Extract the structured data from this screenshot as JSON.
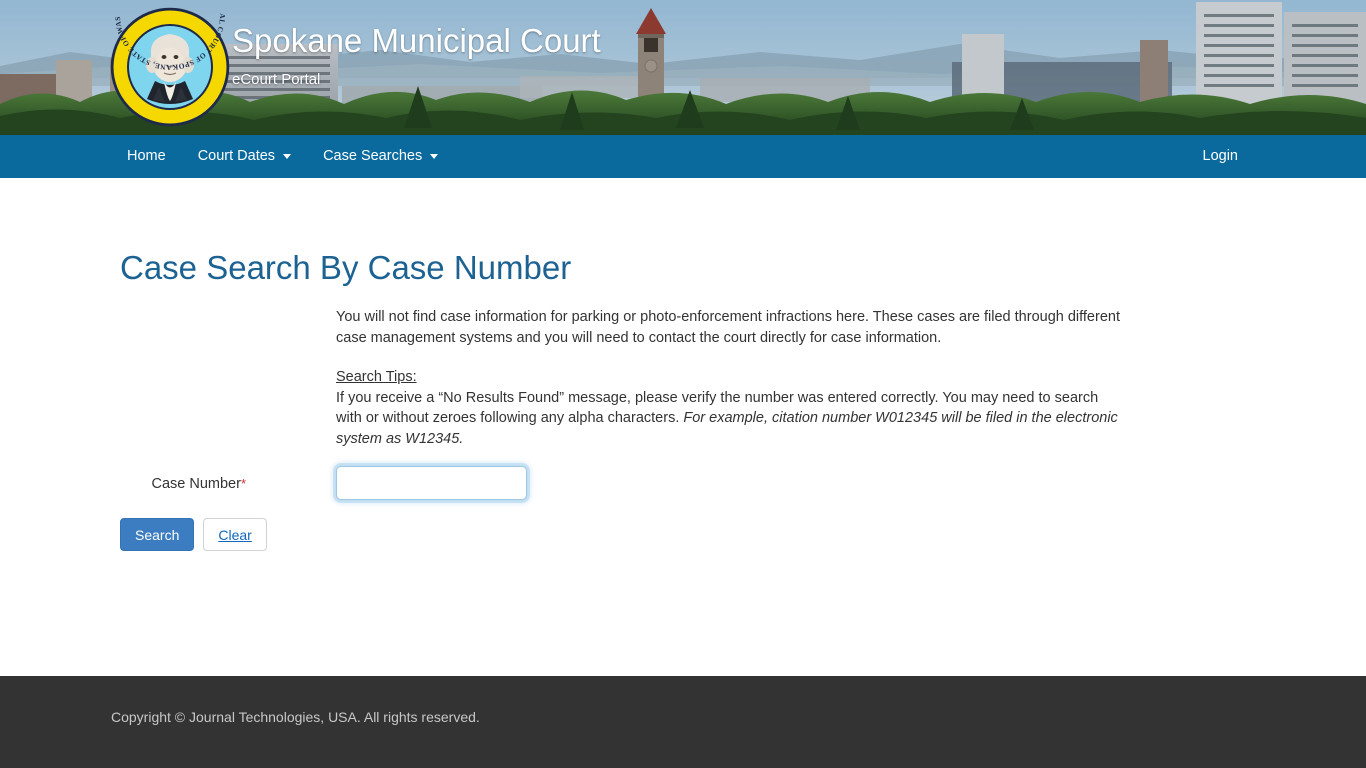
{
  "banner": {
    "title": "Spokane Municipal Court",
    "subtitle": "eCourt Portal",
    "seal_ring_top_text": "MUNICIPAL COURT OF SPOKANE, STATE OF WASHINGTON",
    "seal_ring_bottom_text": "SEAL OF THE",
    "photo_alt": "Spokane skyline with Riverfront Park clock tower",
    "colors": {
      "seal_ring": "#F5D800",
      "seal_field": "#7FD4EE",
      "sky": "#8FB3CC",
      "trees": "#2F5D28"
    }
  },
  "nav": {
    "items": [
      {
        "label": "Home",
        "has_dropdown": false
      },
      {
        "label": "Court Dates",
        "has_dropdown": true
      },
      {
        "label": "Case Searches",
        "has_dropdown": true
      }
    ],
    "login_label": "Login",
    "background": "#0a6a9e"
  },
  "main": {
    "page_title": "Case Search By Case Number",
    "page_title_color": "#1c6293",
    "intro": "You will not find case information for parking or photo-enforcement infractions here. These cases are filed through different case management systems and you will need to contact the court directly for case information.",
    "tips_heading": "Search Tips:",
    "tips_body": "If you receive a “No Results Found” message, please verify the number was entered correctly. You may need to search with or without zeroes following any alpha characters. ",
    "tips_example": "For example, citation number W012345 will be filed in the electronic system as W12345.",
    "form": {
      "case_number_label": "Case Number",
      "required_marker": "*",
      "case_number_value": "",
      "case_number_placeholder": ""
    },
    "buttons": {
      "search_label": "Search",
      "clear_label": "Clear",
      "search_color": "#3c7cc0"
    }
  },
  "footer": {
    "copyright": "Copyright © Journal Technologies, USA. All rights reserved.",
    "background": "#333333"
  }
}
